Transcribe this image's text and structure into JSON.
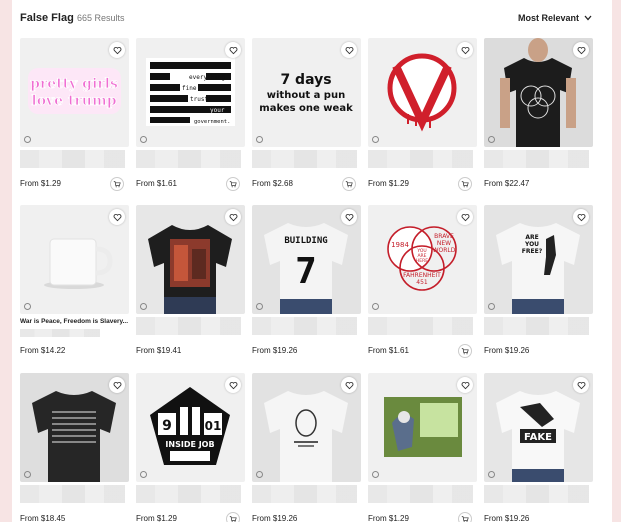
{
  "header": {
    "title": "False Flag",
    "count": "665 Results",
    "sort_label": "Most Relevant"
  },
  "rows": [
    {
      "products": [
        {
          "name": "pretty-girls-sticker",
          "title": "",
          "price": "From $1.29",
          "art_text": [
            "pretty girls",
            "love trump"
          ],
          "cart": true
        },
        {
          "name": "everything-fine-sticker",
          "title": "",
          "price": "From $1.61",
          "art_text": [
            "everything",
            "is",
            "fine",
            "trust",
            "your",
            "government."
          ],
          "cart": true
        },
        {
          "name": "7-days-sticker",
          "title": "",
          "price": "From $2.68",
          "art_text": [
            "7 days",
            "without a pun",
            "makes one weak"
          ],
          "cart": true
        },
        {
          "name": "v-sticker",
          "title": "",
          "price": "From $1.29",
          "art_text": [],
          "cart": true
        },
        {
          "name": "venn-tshirt",
          "title": "",
          "price": "From $22.47",
          "art_text": [],
          "cart": false
        }
      ]
    },
    {
      "products": [
        {
          "name": "war-is-peace-mug",
          "title": "War is Peace, Freedom is Slavery...",
          "price": "From $14.22",
          "art_text": [],
          "cart": false
        },
        {
          "name": "red-print-tshirt",
          "title": "",
          "price": "From $19.41",
          "art_text": [],
          "cart": false
        },
        {
          "name": "building-7-tshirt",
          "title": "",
          "price": "From $19.26",
          "art_text": [
            "BUILDING",
            "7"
          ],
          "cart": false
        },
        {
          "name": "1984-venn-sticker",
          "title": "",
          "price": "From $1.61",
          "art_text": [
            "1984",
            "BRAVE",
            "NEW",
            "WORLD",
            "YOU",
            "ARE",
            "HERE",
            "FAHRENHEIT",
            "451"
          ],
          "cart": true
        },
        {
          "name": "are-you-free-tshirt",
          "title": "",
          "price": "From $19.26",
          "art_text": [
            "ARE",
            "YOU",
            "FREE?"
          ],
          "cart": false
        }
      ]
    },
    {
      "products": [
        {
          "name": "flag-tshirt",
          "title": "",
          "price": "From $18.45",
          "art_text": [],
          "cart": false
        },
        {
          "name": "inside-job-sticker",
          "title": "",
          "price": "From $1.29",
          "art_text": [
            "9",
            "01",
            "INSIDE JOB"
          ],
          "cart": true
        },
        {
          "name": "portrait-tshirt",
          "title": "",
          "price": "From $19.26",
          "art_text": [],
          "cart": false
        },
        {
          "name": "cartoon-sticker",
          "title": "",
          "price": "From $1.29",
          "art_text": [],
          "cart": true
        },
        {
          "name": "fake-tshirt",
          "title": "",
          "price": "From $19.26",
          "art_text": [
            "FAKE"
          ],
          "cart": false
        }
      ]
    }
  ],
  "icons": {
    "wishlist": "heart-icon",
    "cart": "cart-icon",
    "sort": "chevron-down-icon"
  },
  "colors": {
    "page_bg": "#f7e4e4",
    "accent_pink": "#f06fd3",
    "v_red": "#d01f2b"
  }
}
